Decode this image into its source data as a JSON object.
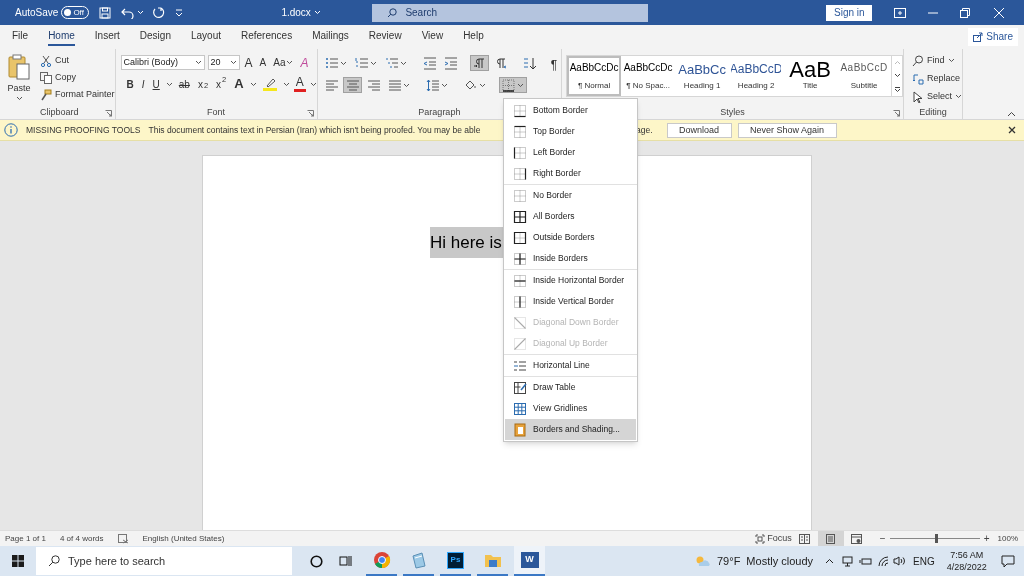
{
  "title_bar": {
    "autosave_label": "AutoSave",
    "autosave_toggle": {
      "label": "Off",
      "on": false
    },
    "document_title": "1.docx",
    "search": {
      "placeholder": "Search"
    },
    "sign_in": "Sign in"
  },
  "tabs": [
    {
      "label": "File",
      "selected": false
    },
    {
      "label": "Home",
      "selected": true
    },
    {
      "label": "Insert",
      "selected": false
    },
    {
      "label": "Design",
      "selected": false
    },
    {
      "label": "Layout",
      "selected": false
    },
    {
      "label": "References",
      "selected": false
    },
    {
      "label": "Mailings",
      "selected": false
    },
    {
      "label": "Review",
      "selected": false
    },
    {
      "label": "View",
      "selected": false
    },
    {
      "label": "Help",
      "selected": false
    }
  ],
  "share": "Share",
  "ribbon": {
    "clipboard": {
      "paste": "Paste",
      "items": [
        {
          "kind": "cut",
          "label": "Cut"
        },
        {
          "kind": "copy",
          "label": "Copy"
        },
        {
          "kind": "painter",
          "label": "Format Painter"
        }
      ],
      "label": "Clipboard"
    },
    "font": {
      "font_name": "Calibri (Body)",
      "font_size": "20",
      "row1": [
        {
          "kind": "grow",
          "text": "A"
        },
        {
          "kind": "shrink",
          "text": "A"
        },
        {
          "kind": "case",
          "text": "Aa"
        },
        {
          "kind": "clear",
          "text": "A"
        }
      ],
      "row2": [
        {
          "kind": "bold",
          "text": "B"
        },
        {
          "kind": "italic",
          "text": "I"
        },
        {
          "kind": "underline",
          "text": "U"
        },
        {
          "kind": "strike",
          "text": "ab"
        },
        {
          "kind": "sub",
          "text": "x$_{2}$"
        },
        {
          "kind": "super",
          "text": "x$^{2}$"
        },
        {
          "kind": "effects",
          "text": "A"
        },
        {
          "kind": "highlight"
        },
        {
          "kind": "color",
          "text": "A"
        }
      ],
      "label": "Font"
    },
    "paragraph": {
      "row1": [
        {
          "kind": "bullets",
          "selected": false
        },
        {
          "kind": "numbering",
          "selected": false
        },
        {
          "kind": "multilevel",
          "selected": false
        },
        {
          "kind": "outdent",
          "selected": false
        },
        {
          "kind": "indent",
          "selected": false
        },
        {
          "kind": "ltr",
          "selected": true
        },
        {
          "kind": "rtl",
          "selected": false
        },
        {
          "kind": "sort",
          "selected": false
        },
        {
          "kind": "marks",
          "selected": false,
          "text": "¶"
        }
      ],
      "row2": [
        {
          "kind": "align-left",
          "selected": false
        },
        {
          "kind": "align-center",
          "selected": true
        },
        {
          "kind": "align-right",
          "selected": false
        },
        {
          "kind": "justify",
          "selected": false
        },
        {
          "kind": "line-spacing",
          "selected": false
        },
        {
          "kind": "shading",
          "selected": false
        },
        {
          "kind": "borders",
          "selected": true
        }
      ],
      "label": "Paragraph"
    },
    "styles": {
      "items": [
        {
          "sample": "AaBbCcDc",
          "name": "¶ Normal",
          "kind": "normal",
          "selected": true
        },
        {
          "sample": "AaBbCcDc",
          "name": "¶ No Spac...",
          "kind": "normal",
          "selected": false
        },
        {
          "sample": "AaBbCc",
          "name": "Heading 1",
          "kind": "heading1",
          "selected": false
        },
        {
          "sample": "AaBbCcD",
          "name": "Heading 2",
          "kind": "heading2",
          "selected": false
        },
        {
          "sample": "AaB",
          "name": "Title",
          "kind": "title",
          "selected": false
        },
        {
          "sample": "AaBbCcD",
          "name": "Subtitle",
          "kind": "subtitle",
          "selected": false
        }
      ],
      "label": "Styles"
    },
    "editing": {
      "items": [
        {
          "kind": "find",
          "label": "Find",
          "dropdown": true
        },
        {
          "kind": "replace",
          "label": "Replace",
          "dropdown": false
        },
        {
          "kind": "select",
          "label": "Select",
          "dropdown": true
        }
      ],
      "label": "Editing"
    }
  },
  "message_bar": {
    "title": "MISSING PROOFING TOOLS",
    "message": "This document contains text in Persian (Iran) which isn't being proofed. You may be able",
    "message_tail": "age.",
    "buttons": [
      "Download",
      "Never Show Again"
    ]
  },
  "document": {
    "text": "Hi here is"
  },
  "borders_menu": {
    "groups": [
      {
        "items": [
          {
            "kind": "bottom",
            "label": "Bottom Border",
            "disabled": false,
            "selected": false
          },
          {
            "kind": "top",
            "label": "Top Border",
            "disabled": false,
            "selected": false
          },
          {
            "kind": "left",
            "label": "Left Border",
            "disabled": false,
            "selected": false
          },
          {
            "kind": "right",
            "label": "Right Border",
            "disabled": false,
            "selected": false
          }
        ]
      },
      {
        "items": [
          {
            "kind": "none",
            "label": "No Border",
            "disabled": false,
            "selected": false
          },
          {
            "kind": "all",
            "label": "All Borders",
            "disabled": false,
            "selected": false
          },
          {
            "kind": "outside",
            "label": "Outside Borders",
            "disabled": false,
            "selected": false
          },
          {
            "kind": "inside",
            "label": "Inside Borders",
            "disabled": false,
            "selected": false
          }
        ]
      },
      {
        "items": [
          {
            "kind": "inside-h",
            "label": "Inside Horizontal Border",
            "disabled": false,
            "selected": false
          },
          {
            "kind": "inside-v",
            "label": "Inside Vertical Border",
            "disabled": false,
            "selected": false
          },
          {
            "kind": "diag-down",
            "label": "Diagonal Down Border",
            "disabled": true,
            "selected": false
          },
          {
            "kind": "diag-up",
            "label": "Diagonal Up Border",
            "disabled": true,
            "selected": false
          }
        ]
      },
      {
        "items": [
          {
            "kind": "hline",
            "label": "Horizontal Line",
            "disabled": false,
            "selected": false
          }
        ]
      },
      {
        "items": [
          {
            "kind": "draw",
            "label": "Draw Table",
            "disabled": false,
            "selected": false
          },
          {
            "kind": "grid",
            "label": "View Gridlines",
            "disabled": false,
            "selected": false
          },
          {
            "kind": "shading",
            "label": "Borders and Shading...",
            "disabled": false,
            "selected": true
          }
        ]
      }
    ]
  },
  "status_bar": {
    "page": "Page 1 of 1",
    "words": "4 of 4 words",
    "language": "English (United States)",
    "focus": "Focus",
    "views": [
      {
        "kind": "read",
        "selected": false
      },
      {
        "kind": "print",
        "selected": true
      },
      {
        "kind": "web",
        "selected": false
      }
    ],
    "zoom": {
      "minus": "−",
      "plus": "+",
      "level": 0.5,
      "reading": "100%"
    }
  },
  "taskbar": {
    "search": {
      "placeholder": "Type here to search"
    },
    "apps": [
      {
        "kind": "chrome",
        "running": true,
        "active": false
      },
      {
        "kind": "notepad",
        "running": true,
        "active": false
      },
      {
        "kind": "photoshop",
        "text": "Ps",
        "running": true,
        "active": false
      },
      {
        "kind": "explorer",
        "running": true,
        "active": false
      },
      {
        "kind": "word",
        "text": "W",
        "running": true,
        "active": true
      }
    ],
    "weather": {
      "temperature": "79°F",
      "condition": "Mostly cloudy"
    },
    "language": "ENG",
    "time": "7:56 AM",
    "date": "4/28/2022"
  }
}
